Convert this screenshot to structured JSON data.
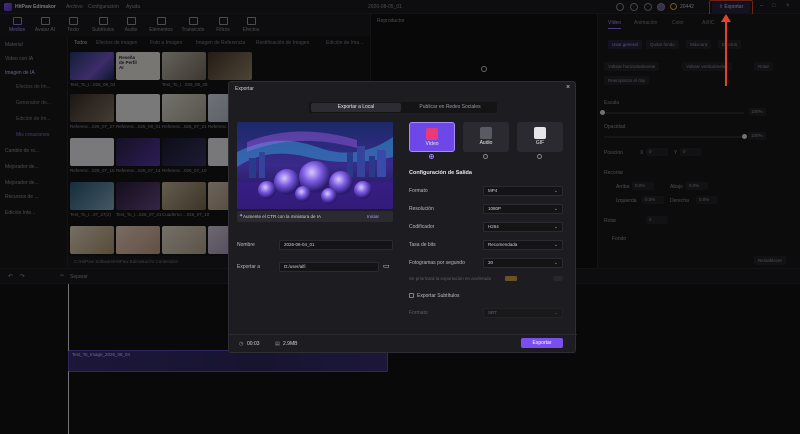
{
  "titlebar": {
    "app_name": "HitPaw Edimakor",
    "menus": [
      "Archivo",
      "Configuración",
      "Ayuda"
    ],
    "doc_title": "2026-08-05_01",
    "coins": "20442",
    "export_label": "Exportar"
  },
  "toolbar": {
    "tools": [
      "Medios",
      "Avatar AI",
      "Texto",
      "Subtítulos",
      "Audio",
      "Elementos",
      "Transición",
      "Filtros",
      "Efectos"
    ]
  },
  "sidebar": {
    "items": [
      "Material",
      "Video con IA",
      "Imagen de IA",
      "Cambio de ro...",
      "Mejorador de...",
      "Mejorador de...",
      "Recursos de ...",
      "Edición Inte..."
    ],
    "subitems": [
      "Efectos de Im...",
      "Generador de...",
      "Edición de Im..."
    ],
    "my_creations": "Mis creaciones"
  },
  "media": {
    "tabs": [
      "Todos",
      "Efectos de imagen",
      "Foto a Imagen",
      "Imagen de Referencia",
      "Restificación de Imagen",
      "Edición de Ima..."
    ],
    "captions": [
      "Text_To_I...026_08_04",
      "Reseña de Perfil AI",
      "Text_To_I...026_08_05",
      "",
      "Referenc...026_07_27",
      "Referenc...026_08_01",
      "Referenc...026_07_21",
      "Referenc...026_07_15",
      "Referenc...026_07_15",
      "Referenc...026_07_14",
      "Referenc...026_07_10",
      "",
      "Text_To_I...07_27(2)",
      "Text_To_I...026_07_01",
      "Cuaderno ...026_07_10",
      ""
    ],
    "card_text": "Reseña de Perfil AI",
    "path": "C:/HitPaw Software/HitPaw Edimakor/AI Contenidos"
  },
  "preview": {
    "title": "Reproductor"
  },
  "props": {
    "tabs": [
      "Vídeo",
      "Animación",
      "Color",
      "AI/IIC"
    ],
    "subtabs": [
      "Usar general",
      "Quitar fondo",
      "Máscara",
      "Efectos"
    ],
    "buttons": [
      "Voltear horizontalmente",
      "Voltear verticalmente",
      "Rotar",
      "Reemplazar el clip"
    ],
    "scale_label": "Escala",
    "scale_value": "100%",
    "opacity_label": "Opacidad",
    "opacity_value": "100%",
    "position_label": "Posición",
    "position_x_label": "X",
    "position_x_value": "0",
    "position_y_label": "Y",
    "position_y_value": "0",
    "crop_label": "Recortar",
    "crop_fields": [
      "Arriba",
      "Abajo",
      "Izquierda",
      "Derecha"
    ],
    "crop_value": "0.0%",
    "rotate_label": "Rotar",
    "rotate_value": "0",
    "fondo_label": "Fondo",
    "reset_label": "Restablecer"
  },
  "timeline": {
    "separate_label": "Separar",
    "clip_label": "Text_To_Image_2026_08_04"
  },
  "dialog": {
    "title": "Exportar",
    "segments": [
      "Exportar a Local",
      "Publicar en Redes Sociales"
    ],
    "ctr_text": "Aumente el CTR con la miniatura de IA",
    "ctr_action": "Iniciar",
    "name_label": "Nombre",
    "name_value": "2026-08-04_01",
    "export_to_label": "Exportar a",
    "export_to_value": "D:/user/alfi",
    "formats": [
      "Vídeo",
      "Audio",
      "GIF"
    ],
    "config_title": "Configuración de Salida",
    "config": [
      {
        "label": "Formato",
        "value": "MP4"
      },
      {
        "label": "Resolución",
        "value": "1080P"
      },
      {
        "label": "Codificador",
        "value": "H264"
      },
      {
        "label": "Tasa de bits",
        "value": "Recomendada"
      },
      {
        "label": "Fotogramas por segundo",
        "value": "30"
      }
    ],
    "gpu_label": "Se priorizará la exportación en acelerada",
    "subtitles_label": "Exportar Subtítulos",
    "sub_format_label": "Formato",
    "sub_format_value": "SRT",
    "duration": "00:03",
    "size": "2.9MB",
    "export_button": "Exportar"
  },
  "colors": {
    "accent": "#7a4ff0",
    "annotation": "#e0442e"
  }
}
